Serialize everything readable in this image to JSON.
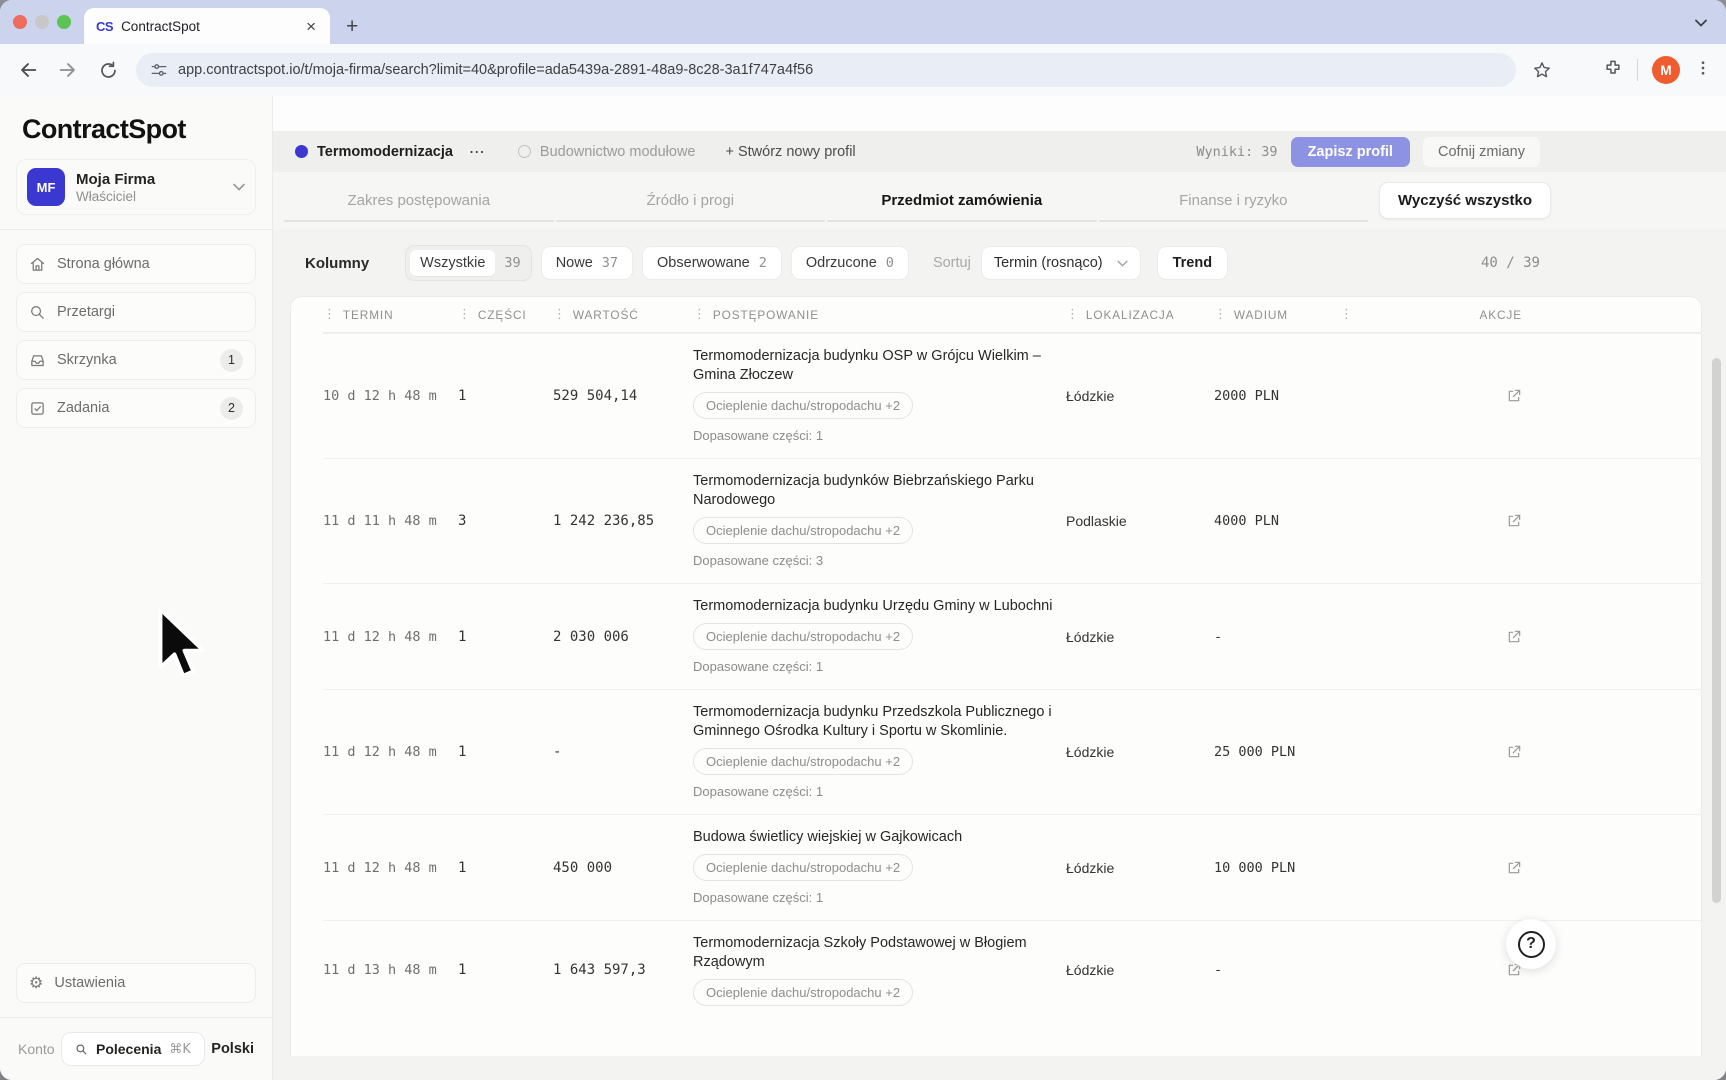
{
  "browser": {
    "tab_title": "ContractSpot",
    "favicon_text": "CS",
    "url": "app.contractspot.io/t/moja-firma/search?limit=40&profile=ada5439a-2891-48a9-8c28-3a1f747a4f56",
    "profile_initial": "M"
  },
  "sidebar": {
    "logo": "ContractSpot",
    "org": {
      "initials": "MF",
      "name": "Moja Firma",
      "role": "Właściciel"
    },
    "nav": [
      {
        "label": "Strona główna"
      },
      {
        "label": "Przetargi"
      },
      {
        "label": "Skrzynka",
        "badge": "1"
      },
      {
        "label": "Zadania",
        "badge": "2"
      }
    ],
    "settings_label": "Ustawienia",
    "footer": {
      "account_label": "Konto",
      "commands_label": "Polecenia",
      "commands_shortcut": "⌘K",
      "language": "Polski"
    }
  },
  "profiles_bar": {
    "active_profile": "Termomodernizacja",
    "inactive_profile": "Budownictwo modułowe",
    "create_profile": "+ Stwórz nowy profil",
    "results_label": "Wyniki:",
    "results_value": "39",
    "save_button": "Zapisz profil",
    "undo_button": "Cofnij zmiany"
  },
  "filter_tabs": {
    "items": [
      {
        "label": "Zakres postępowania",
        "active": false
      },
      {
        "label": "Źródło i progi",
        "active": false
      },
      {
        "label": "Przedmiot zamówienia",
        "active": true
      },
      {
        "label": "Finanse i ryzyko",
        "active": false
      }
    ],
    "clear_all": "Wyczyść wszystko"
  },
  "toolbar_filters": {
    "columns_label": "Kolumny",
    "chips": [
      {
        "label": "Wszystkie",
        "count": "39",
        "selected": true
      },
      {
        "label": "Nowe",
        "count": "37",
        "selected": false
      },
      {
        "label": "Obserwowane",
        "count": "2",
        "selected": false
      },
      {
        "label": "Odrzucone",
        "count": "0",
        "selected": false
      }
    ],
    "sort_label": "Sortuj",
    "sort_value": "Termin (rosnąco)",
    "trend_button": "Trend",
    "counter": "40 / 39"
  },
  "table": {
    "headers": {
      "termin": "TERMIN",
      "czesci": "CZĘŚCI",
      "wartosc": "WARTOŚĆ",
      "postepowanie": "POSTĘPOWANIE",
      "lokalizacja": "LOKALIZACJA",
      "wadium": "WADIUM",
      "akcje": "AKCJE"
    },
    "rows": [
      {
        "termin": "10 d 12 h 48 m",
        "czesci": "1",
        "wartosc": "529 504,14",
        "title": "Termomodernizacja budynku OSP w Grójcu Wielkim – Gmina Złoczew",
        "tag": "Ocieplenie dachu/stropodachu +2",
        "matched": "Dopasowane części: 1",
        "lokalizacja": "Łódzkie",
        "wadium": "2000 PLN"
      },
      {
        "termin": "11 d 11 h 48 m",
        "czesci": "3",
        "wartosc": "1 242 236,85",
        "title": "Termomodernizacja budynków Biebrzańskiego Parku Narodowego",
        "tag": "Ocieplenie dachu/stropodachu +2",
        "matched": "Dopasowane części: 3",
        "lokalizacja": "Podlaskie",
        "wadium": "4000 PLN"
      },
      {
        "termin": "11 d 12 h 48 m",
        "czesci": "1",
        "wartosc": "2 030 006",
        "title": "Termomodernizacja budynku Urzędu Gminy w Lubochni",
        "tag": "Ocieplenie dachu/stropodachu +2",
        "matched": "Dopasowane części: 1",
        "lokalizacja": "Łódzkie",
        "wadium": "-"
      },
      {
        "termin": "11 d 12 h 48 m",
        "czesci": "1",
        "wartosc": "-",
        "title": "Termomodernizacja budynku Przedszkola Publicznego i Gminnego Ośrodka Kultury i Sportu w Skomlinie.",
        "tag": "Ocieplenie dachu/stropodachu +2",
        "matched": "Dopasowane części: 1",
        "lokalizacja": "Łódzkie",
        "wadium": "25 000 PLN"
      },
      {
        "termin": "11 d 12 h 48 m",
        "czesci": "1",
        "wartosc": "450 000",
        "title": "Budowa świetlicy wiejskiej w Gajkowicach",
        "tag": "Ocieplenie dachu/stropodachu +2",
        "matched": "Dopasowane części: 1",
        "lokalizacja": "Łódzkie",
        "wadium": "10 000 PLN"
      },
      {
        "termin": "11 d 13 h 48 m",
        "czesci": "1",
        "wartosc": "1 643 597,3",
        "title": "Termomodernizacja Szkoły Podstawowej w Błogiem Rządowym",
        "tag": "Ocieplenie dachu/stropodachu +2",
        "lokalizacja": "Łódzkie",
        "wadium": "-"
      }
    ]
  },
  "colors": {
    "accent_indigo": "#3a38d0",
    "save_button_purple": "#8e92e3",
    "avatar_orange": "#ee5c2f",
    "tabstrip_periwinkle": "#ccd3ed"
  }
}
